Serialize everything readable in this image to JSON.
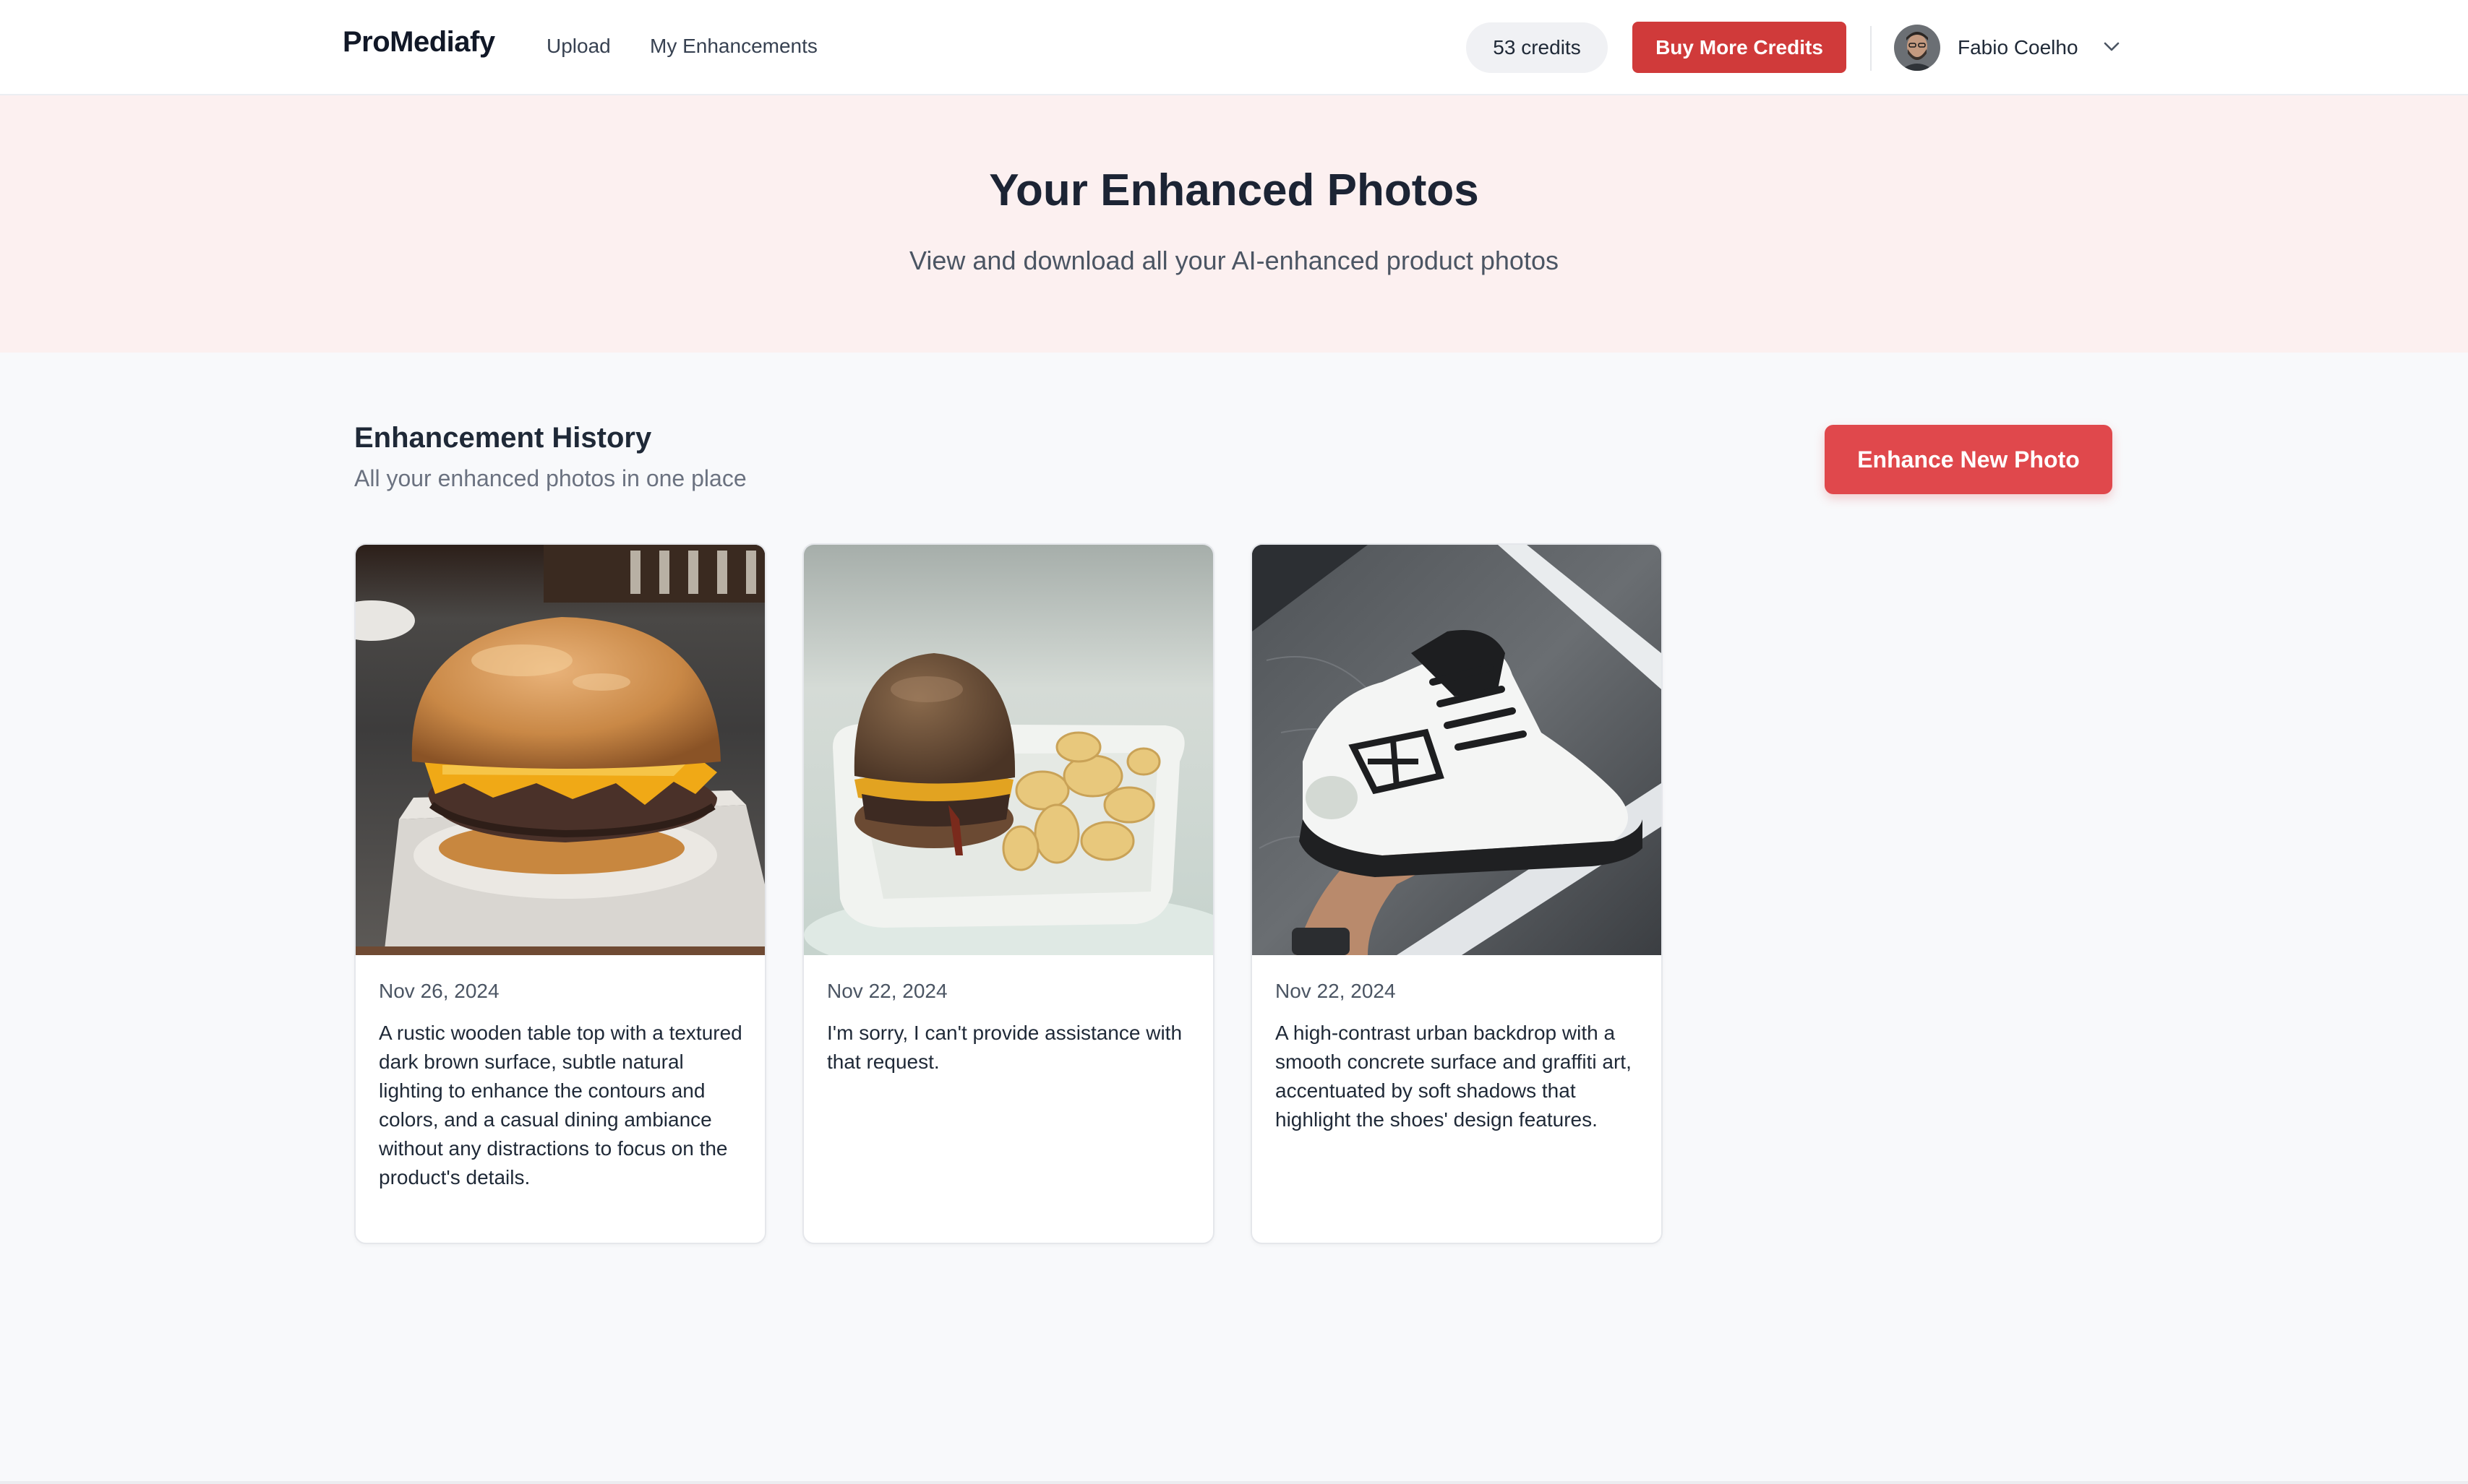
{
  "nav": {
    "logo": "ProMediafy",
    "links": [
      "Upload",
      "My Enhancements"
    ],
    "credits": "53 credits",
    "buy_button": "Buy More Credits",
    "user_name": "Fabio Coelho"
  },
  "hero": {
    "title": "Your Enhanced Photos",
    "subtitle": "View and download all your AI-enhanced product photos"
  },
  "section": {
    "title": "Enhancement History",
    "subtitle": "All your enhanced photos in one place",
    "enhance_button": "Enhance New Photo"
  },
  "cards": [
    {
      "date": "Nov 26, 2024",
      "description": "A rustic wooden table top with a textured dark brown surface, subtle natural lighting to enhance the contours and colors, and a casual dining ambiance without any distractions to focus on the product's details.",
      "image": "burger-on-wooden-table"
    },
    {
      "date": "Nov 22, 2024",
      "description": "I'm sorry, I can't provide assistance with that request.",
      "image": "burger-with-fries-on-plate"
    },
    {
      "date": "Nov 22, 2024",
      "description": "A high-contrast urban backdrop with a smooth concrete surface and graffiti art, accentuated by soft shadows that highlight the shoes' design features.",
      "image": "white-sneaker-in-hand"
    }
  ],
  "colors": {
    "brand_red": "#d03a3a",
    "cta_red": "#e0484c",
    "hero_bg": "#fcf0f0",
    "page_bg": "#f8f9fb"
  },
  "icons": [
    "chevron-down-icon",
    "avatar-photo"
  ]
}
